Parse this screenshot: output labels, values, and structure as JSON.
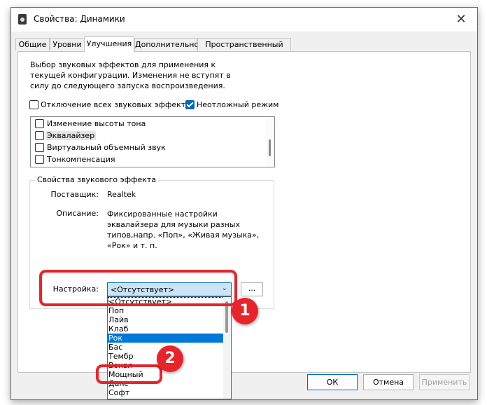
{
  "window": {
    "title": "Свойства: Динамики",
    "close_glyph": "✕"
  },
  "tabs": [
    {
      "label": "Общие",
      "active": false
    },
    {
      "label": "Уровни",
      "active": false
    },
    {
      "label": "Улучшения",
      "active": true
    },
    {
      "label": "Дополнительно",
      "active": false
    },
    {
      "label": "Пространственный звук",
      "active": false
    }
  ],
  "enhancements": {
    "description": "Выбор звуковых эффектов для применения к текущей конфигурации. Изменения не вступят в силу до следующего запуска воспроизведения.",
    "disable_all": {
      "label": "Отключение всех звуковых эффектов",
      "checked": false
    },
    "immediate_mode": {
      "label": "Неотложный режим",
      "checked": true
    },
    "effects": [
      {
        "label": "Изменение высоты тона",
        "checked": false,
        "selected": false
      },
      {
        "label": "Эквалайзер",
        "checked": false,
        "selected": true
      },
      {
        "label": "Виртуальный объемный звук",
        "checked": false,
        "selected": false
      },
      {
        "label": "Тонкомпенсация",
        "checked": false,
        "selected": false
      }
    ]
  },
  "properties": {
    "group_title": "Свойства звукового эффекта",
    "provider_label": "Поставщик:",
    "provider_value": "Realtek",
    "description_label": "Описание:",
    "description_value": "Фиксированные настройки эквалайзера для музыки разных типов,напр. «Поп», «Живая музыка», «Рок» и т. п.",
    "setting_label": "Настройка:",
    "setting_value": "<Отсутствует>",
    "more_button": "...",
    "dropdown_options": [
      "<Отсутствует>",
      "Поп",
      "Лайв",
      "Клаб",
      "Рок",
      "Бас",
      "Тембр",
      "Вокал",
      "Мощный",
      "Данс",
      "Софт"
    ],
    "highlighted_option": "Рок"
  },
  "buttons": {
    "ok": "ОК",
    "cancel": "Отмена",
    "apply": "Применить"
  },
  "annotations": {
    "badge1": "1",
    "badge2": "2",
    "color": "#e8242a"
  },
  "colors": {
    "accent": "#0067c0",
    "highlight": "#0078d7"
  }
}
